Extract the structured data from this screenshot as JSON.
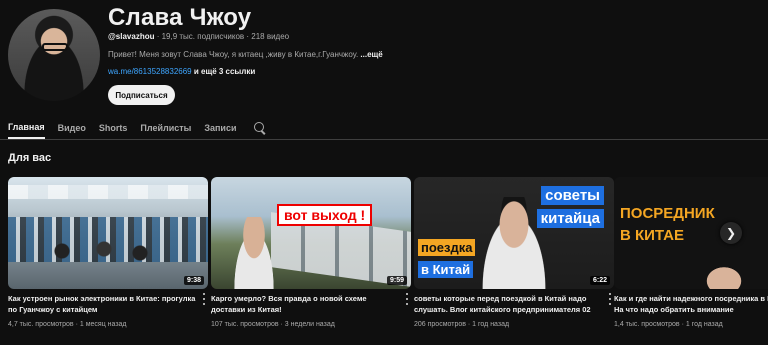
{
  "channel": {
    "name": "Слава Чжоу",
    "handle": "@slavazhou",
    "subscribers": " · 19,9 тыс. подписчиков · 218 видео",
    "description": "Привет! Меня зовут Слава Чжоу, я китаец ,живу в Китае,г.Гуанчжоу. ",
    "more": "...ещё",
    "link": "wa.me/8613528832669",
    "extra_links": " и ещё 3 ссылки",
    "subscribe_label": "Подписаться"
  },
  "tabs": [
    "Главная",
    "Видео",
    "Shorts",
    "Плейлисты",
    "Записи"
  ],
  "section_title": "Для вас",
  "videos": [
    {
      "title": "Как устроен рынок электроники в Китае: прогулка по Гуанчжоу с китайцем",
      "stats": "4,7 тыс. просмотров · 1 месяц назад",
      "duration": "9:38"
    },
    {
      "title": "Карго умерло? Вся правда о новой схеме доставки из Китая!",
      "stats": "107 тыс. просмотров · 3 недели назад",
      "duration": "9:59",
      "overlay": "вот выход !"
    },
    {
      "title": "советы которые перед поездкой в Китай надо слушать. Влог китайского предпринимателя 02",
      "stats": "206 просмотров · 1 год назад",
      "duration": "6:22",
      "overlay_1": "советы",
      "overlay_2": "китайца",
      "overlay_3": "поездка",
      "overlay_4": "в Китай"
    },
    {
      "title": "Как и где найти надежного посредника в Китае? На что надо обратить внимание",
      "stats": "1,4 тыс. просмотров · 1 год назад",
      "overlay_1": "ПОСРЕДНИК",
      "overlay_2": "В КИТАЕ"
    }
  ],
  "icons": {
    "search": "search-icon",
    "next": "chevron-right-icon",
    "menu": "more-vert-icon"
  }
}
